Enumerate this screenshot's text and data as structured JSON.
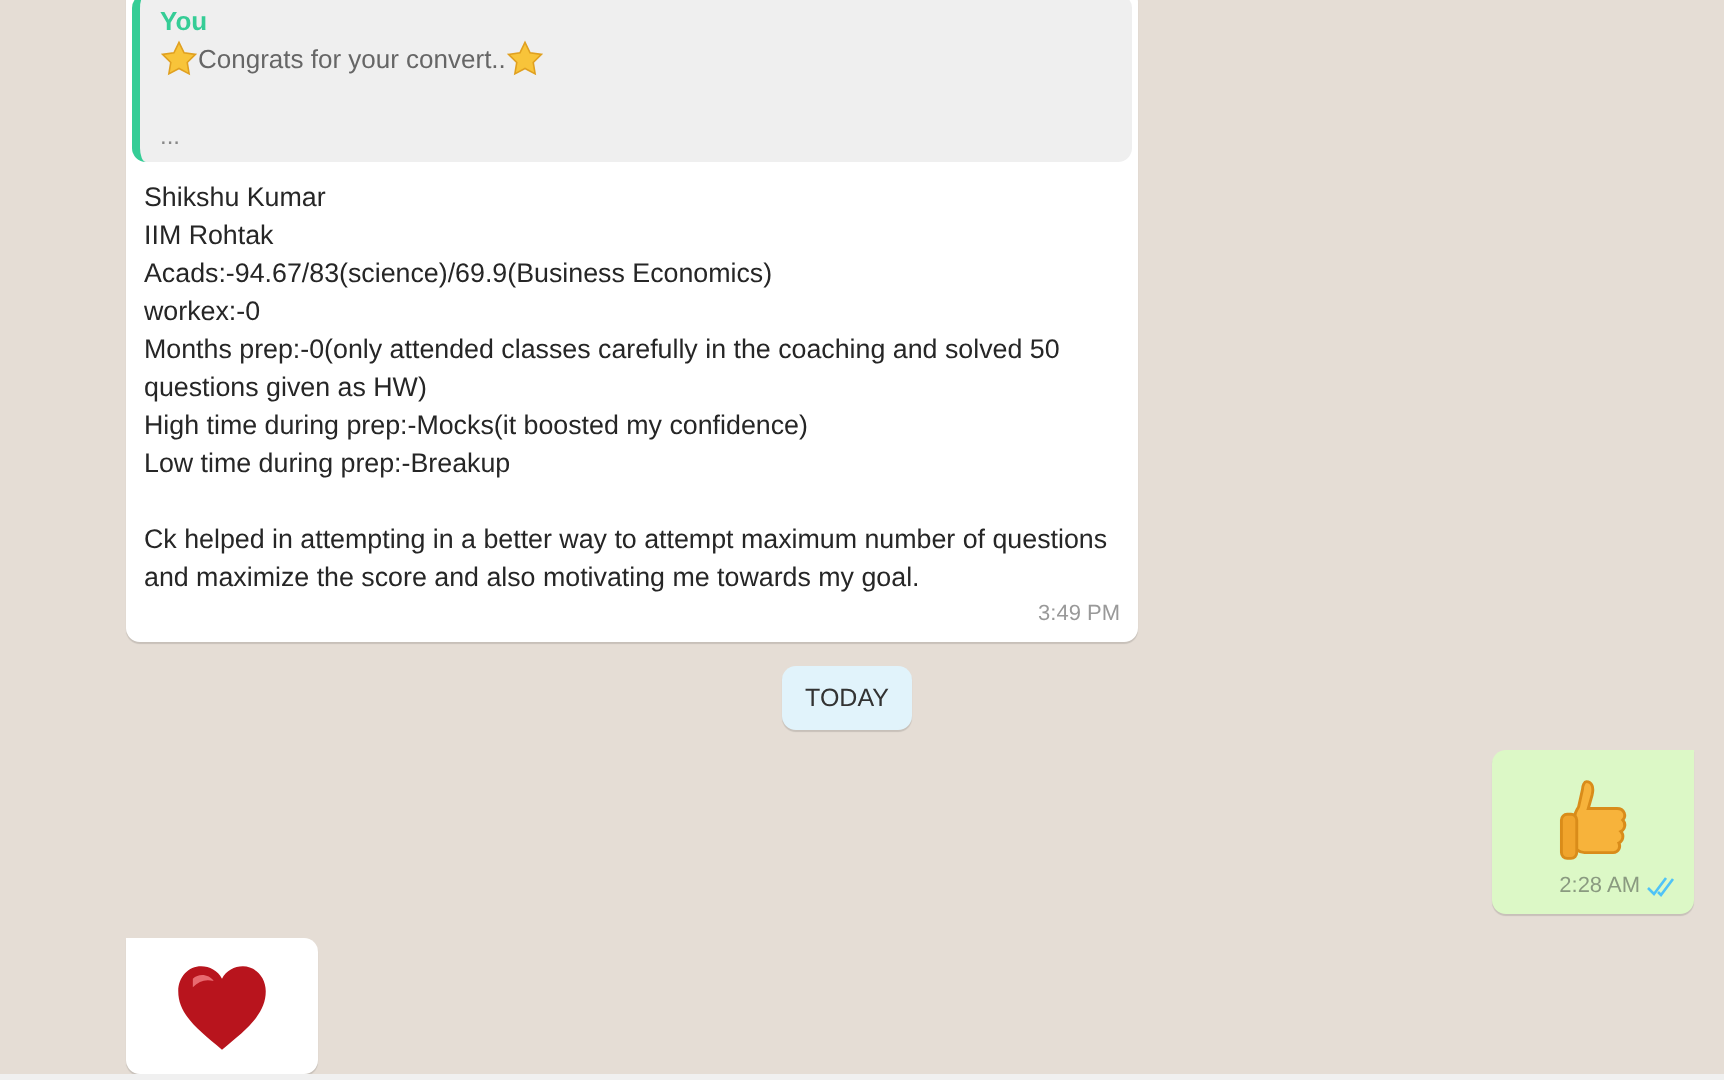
{
  "messages": [
    {
      "kind": "text",
      "quote": {
        "author": "You",
        "text": "Congrats for your convert..",
        "more": "..."
      },
      "paragraphs": [
        [
          "Shikshu Kumar",
          "IIM Rohtak",
          "Acads:-94.67/83(science)/69.9(Business Economics)",
          "workex:-0",
          "Months prep:-0(only attended classes carefully in the coaching and solved 50 questions given as HW)",
          "High time during prep:-Mocks(it boosted my confidence)",
          "Low time during prep:-Breakup"
        ],
        [
          "Ck helped in attempting in a better way to attempt maximum number of questions and maximize the score and also motivating me towards my goal."
        ]
      ],
      "time": "3:49 PM"
    },
    {
      "kind": "date",
      "label": "TODAY"
    },
    {
      "kind": "thumbs",
      "time": "2:28 AM",
      "read": true
    },
    {
      "kind": "heart"
    }
  ]
}
